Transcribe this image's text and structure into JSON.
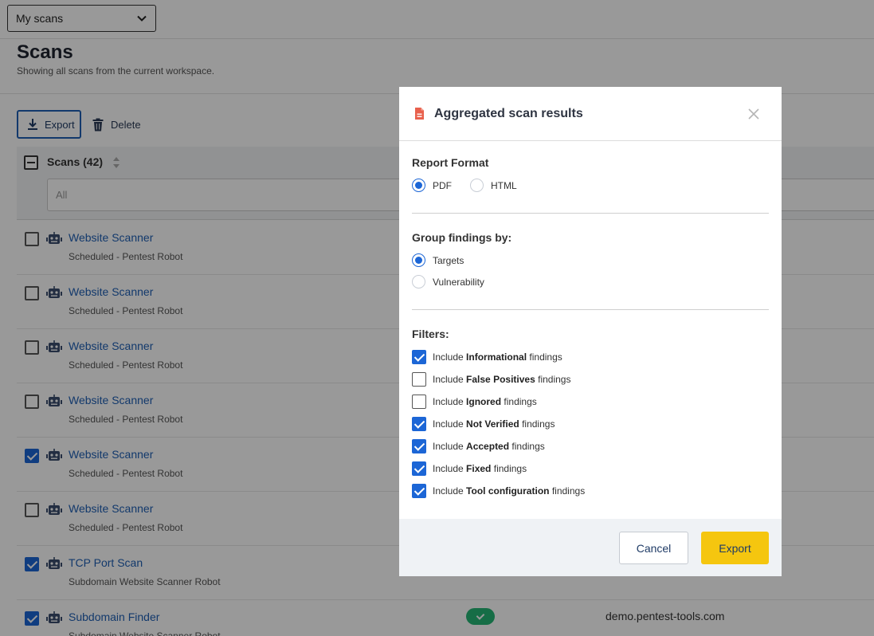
{
  "header": {
    "scope_select": "My scans",
    "title": "Scans",
    "subtitle": "Showing all scans from the current workspace."
  },
  "toolbar": {
    "export_label": "Export",
    "delete_label": "Delete"
  },
  "table": {
    "header_label": "Scans (42)",
    "filter_placeholder": "All",
    "rows": [
      {
        "name": "Website Scanner",
        "sub": "Scheduled - Pentest Robot",
        "checked": false
      },
      {
        "name": "Website Scanner",
        "sub": "Scheduled - Pentest Robot",
        "checked": false
      },
      {
        "name": "Website Scanner",
        "sub": "Scheduled - Pentest Robot",
        "checked": false
      },
      {
        "name": "Website Scanner",
        "sub": "Scheduled - Pentest Robot",
        "checked": false
      },
      {
        "name": "Website Scanner",
        "sub": "Scheduled - Pentest Robot",
        "checked": true
      },
      {
        "name": "Website Scanner",
        "sub": "Scheduled - Pentest Robot",
        "checked": false
      },
      {
        "name": "TCP Port Scan",
        "sub": "Subdomain Website Scanner Robot",
        "checked": true
      },
      {
        "name": "Subdomain Finder",
        "sub": "Subdomain Website Scanner Robot",
        "checked": true,
        "target": "demo.pentest-tools.com"
      }
    ]
  },
  "modal": {
    "title": "Aggregated scan results",
    "report_format": {
      "title": "Report Format",
      "options": [
        {
          "label": "PDF",
          "selected": true
        },
        {
          "label": "HTML",
          "selected": false
        }
      ]
    },
    "group_by": {
      "title": "Group findings by:",
      "options": [
        {
          "label": "Targets",
          "selected": true
        },
        {
          "label": "Vulnerability",
          "selected": false
        }
      ]
    },
    "filters": {
      "title": "Filters:",
      "prefix": "Include",
      "suffix": "findings",
      "items": [
        {
          "label": "Informational",
          "checked": true
        },
        {
          "label": "False Positives",
          "checked": false
        },
        {
          "label": "Ignored",
          "checked": false
        },
        {
          "label": "Not Verified",
          "checked": true
        },
        {
          "label": "Accepted",
          "checked": true
        },
        {
          "label": "Fixed",
          "checked": true
        },
        {
          "label": "Tool configuration",
          "checked": true
        }
      ]
    },
    "cancel_label": "Cancel",
    "export_label": "Export"
  },
  "colors": {
    "accent_blue": "#1c66d6",
    "export_yellow": "#f5c60f",
    "success_green": "#25b676",
    "doc_icon_red": "#e8604c"
  }
}
